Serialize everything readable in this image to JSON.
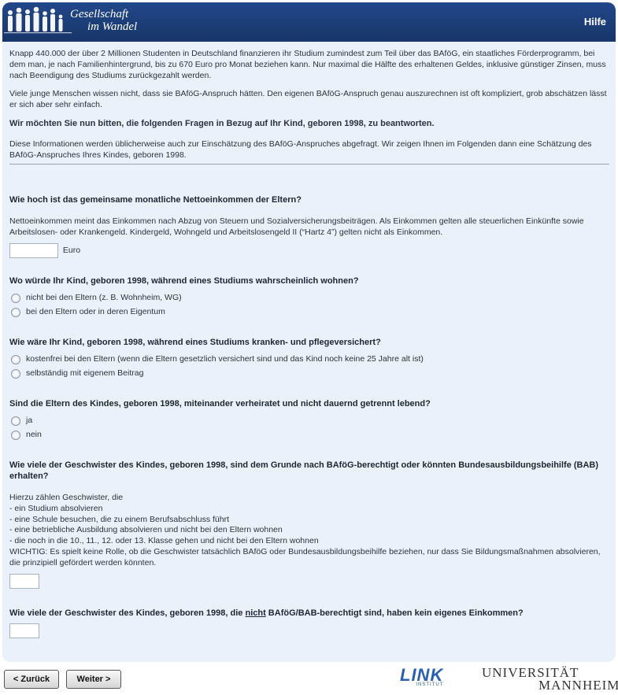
{
  "header": {
    "logo_line1": "Gesellschaft",
    "logo_line2": "im Wandel",
    "help_label": "Hilfe"
  },
  "intro": {
    "p1": "Knapp 440.000 der über 2 Millionen Studenten in Deutschland finanzieren ihr Studium zumindest zum Teil über das BAföG, ein staatliches Förderprogramm, bei dem man, je nach Familienhintergrund, bis zu 670 Euro pro Monat beziehen kann. Nur maximal die Hälfte des erhaltenen Geldes, inklusive günstiger Zinsen, muss nach Beendigung des Studiums zurückgezahlt werden.",
    "p2": "Viele junge Menschen wissen nicht, dass sie BAföG-Anspruch hätten. Den eigenen BAföG-Anspruch genau auszurechnen ist oft kompliziert, grob abschätzen lässt er sich aber sehr einfach.",
    "p3": "Wir möchten Sie nun bitten, die folgenden Fragen in Bezug auf Ihr Kind, geboren 1998, zu beantworten.",
    "p4": "Diese Informationen werden üblicherweise auch zur Einschätzung des BAföG-Anspruches abgefragt. Wir zeigen Ihnen im Folgenden dann eine Schätzung des BAföG-Anspruches Ihres Kindes, geboren 1998."
  },
  "q1": {
    "title": "Wie hoch ist das gemeinsame monatliche Nettoeinkommen der Eltern?",
    "note": "Nettoeinkommen meint das Einkommen nach Abzug von Steuern und Sozialversicherungsbeiträgen. Als Einkommen gelten alle steuerlichen Einkünfte sowie Arbeitslosen- oder Krankengeld. Kindergeld, Wohngeld und Arbeitslosengeld II (“Hartz 4”) gelten nicht als Einkommen.",
    "value": "",
    "unit": "Euro"
  },
  "q2": {
    "title": "Wo würde Ihr Kind, geboren 1998, während eines Studiums wahrscheinlich wohnen?",
    "options": [
      "nicht bei den Eltern (z. B. Wohnheim, WG)",
      "bei den Eltern oder in deren Eigentum"
    ]
  },
  "q3": {
    "title": "Wie wäre Ihr Kind, geboren 1998, während eines Studiums kranken- und pflegeversichert?",
    "options": [
      "kostenfrei bei den Eltern (wenn die Eltern gesetzlich versichert sind und das Kind noch keine 25 Jahre alt ist)",
      "selbständig mit eigenem Beitrag"
    ]
  },
  "q4": {
    "title": "Sind die Eltern des Kindes, geboren 1998, miteinander verheiratet und nicht dauernd getrennt lebend?",
    "options": [
      "ja",
      "nein"
    ]
  },
  "q5": {
    "title": "Wie viele der Geschwister des Kindes, geboren 1998, sind dem Grunde nach BAföG-berechtigt oder könnten Bundesausbildungsbeihilfe (BAB) erhalten?",
    "note_lines": [
      "Hierzu zählen Geschwister, die",
      "- ein Studium absolvieren",
      "- eine Schule besuchen, die zu einem Berufsabschluss führt",
      "- eine betriebliche Ausbildung absolvieren und nicht bei den Eltern wohnen",
      "- die noch in die 10., 11., 12. oder 13. Klasse gehen und nicht bei den Eltern wohnen",
      "WICHTIG: Es spielt keine Rolle, ob die Geschwister tatsächlich BAföG oder Bundesausbildungsbeihilfe beziehen, nur dass Sie Bildungsmaßnahmen absolvieren, die prinzipiell gefördert werden könnten."
    ],
    "value": ""
  },
  "q6": {
    "title_pre": "Wie viele der Geschwister des Kindes, geboren 1998, die ",
    "title_underlined": "nicht",
    "title_post": " BAföG/BAB-berechtigt sind, haben kein eigenes Einkommen?",
    "value": ""
  },
  "footer": {
    "back_label": "< Zurück",
    "next_label": "Weiter >",
    "link_logo": "LINK",
    "link_logo_sub": "INSTITUT",
    "uni_line1": "UNIVERSITÄT",
    "uni_line2": "MANNHEIM"
  },
  "colors": {
    "header_bg": "#1a3a73",
    "panel_bg": "#eaf1fa",
    "link_blue": "#2b5fb0"
  }
}
